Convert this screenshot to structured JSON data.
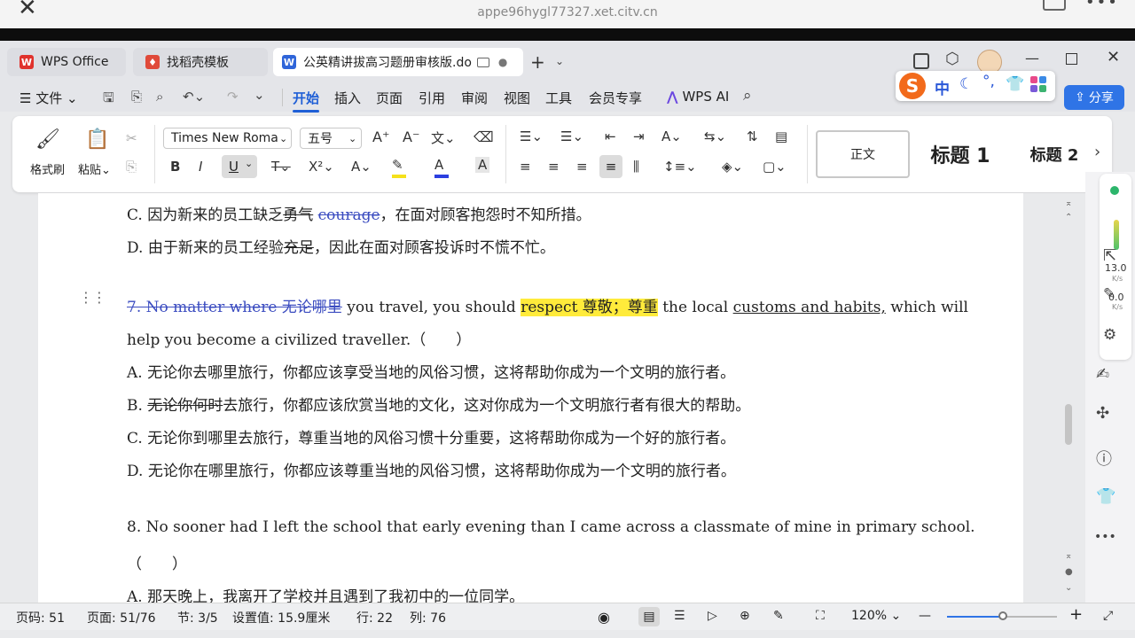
{
  "browser": {
    "page_title": "公英精讲拔高习题册审核版",
    "url": "appe96hygl77327.xet.citv.cn"
  },
  "tabs": {
    "wps": "WPS Office",
    "template": "找稻壳模板",
    "doc": "公英精讲拔高习题册审核版.do"
  },
  "menu": {
    "file": "文件",
    "items": [
      "开始",
      "插入",
      "页面",
      "引用",
      "审阅",
      "视图",
      "工具",
      "会员专享"
    ],
    "wps_ai": "WPS AI",
    "share": "分享"
  },
  "ribbon": {
    "format_painter": "格式刷",
    "paste": "粘贴",
    "font_name": "Times New Roman",
    "font_size": "五号",
    "style_normal": "正文",
    "style_h1": "标题 1",
    "style_h2": "标题 2"
  },
  "ime": {
    "mode": "中"
  },
  "document": {
    "q6c_pre": "C.  因为新来的员工缺乏",
    "q6c_strike1": "勇气",
    "q6c_strike2": "courage",
    "q6c_post": "，在面对顾客抱怨时不知所措。",
    "q6d_pre": "D.  由于新来的员工经验",
    "q6d_strike": "充足",
    "q6d_post": "，因此在面对顾客投诉时不慌不忙。",
    "q7_strike": "7. No matter where 无论哪里",
    "q7_a": " you travel, you should ",
    "q7_hl": "respect 尊敬；尊重",
    "q7_b": " the local ",
    "q7_ul": "customs and habits,",
    "q7_c": " which will",
    "q7_line2": "help you become a civilized traveller.（　　）",
    "q7a": "A.  无论你去哪里旅行，你都应该享受当地的风俗习惯，这将帮助你成为一个文明的旅行者。",
    "q7b_pre": "B.  ",
    "q7b_strike": "无论你何时",
    "q7b_post": "去旅行，你都应该欣赏当地的文化，这对你成为一个文明旅行者有很大的帮助。",
    "q7c": "C.  无论你到哪里去旅行，尊重当地的风俗习惯十分重要，这将帮助你成为一个好的旅行者。",
    "q7d": "D.  无论你在哪里旅行，你都应该尊重当地的风俗习惯，这将帮助你成为一个文明的旅行者。",
    "q8": "8. No sooner had I left the school that early evening than I came across a classmate of mine in primary school.",
    "q8_paren": "（　　）",
    "q8a": "A.  那天晚上，我离开了学校并且遇到了我初中的一位同学。"
  },
  "side": {
    "speed1": "13.0",
    "speed2": "0.0",
    "unit": "K/s"
  },
  "status": {
    "page_code": "页码: 51",
    "page": "页面: 51/76",
    "section": "节: 3/5",
    "setting": "设置值: 15.9厘米",
    "row": "行: 22",
    "col": "列: 76",
    "zoom": "120%"
  }
}
